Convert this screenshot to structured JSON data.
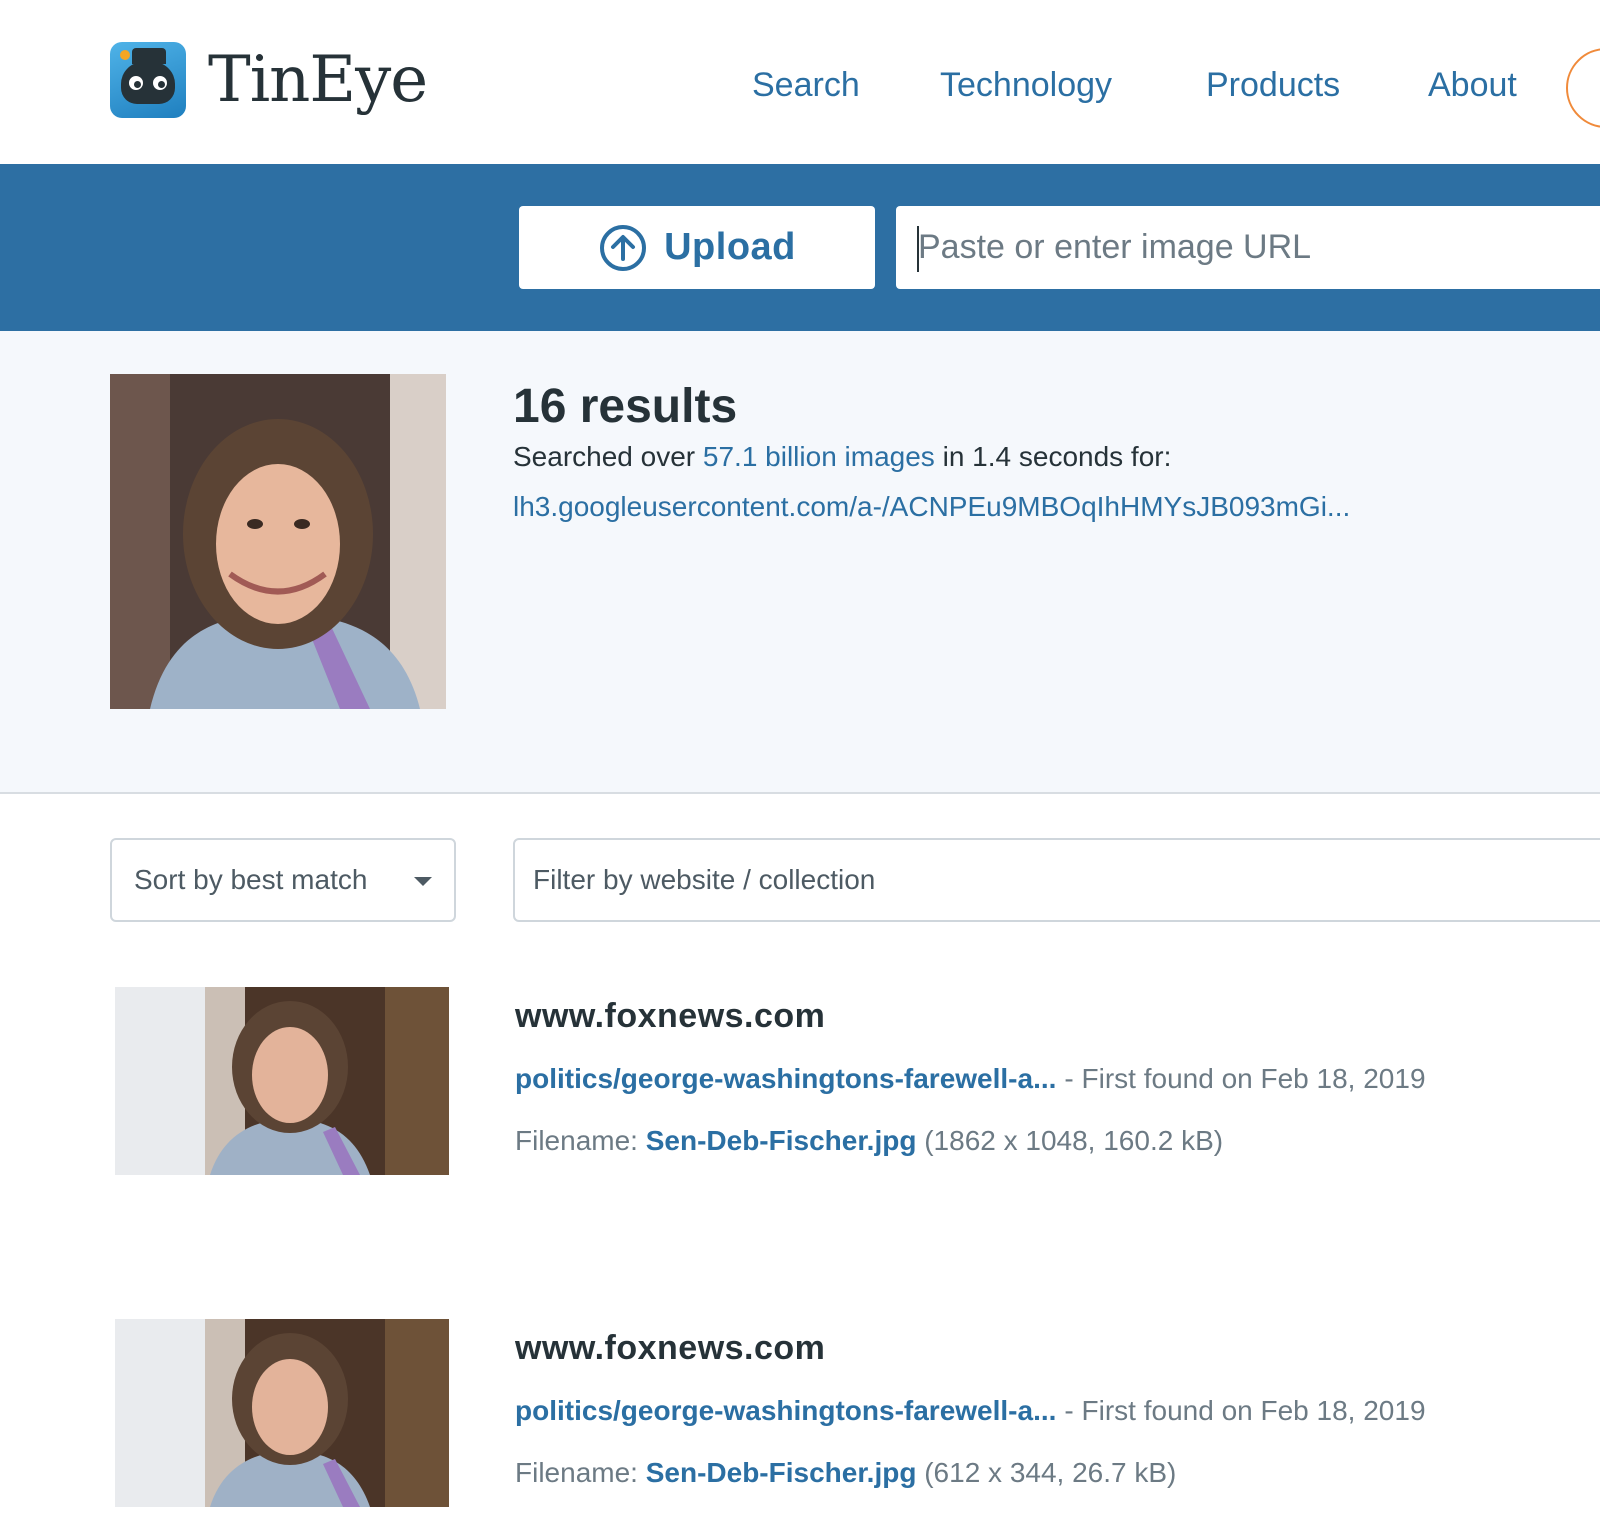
{
  "brand": {
    "name": "TinEye"
  },
  "nav": {
    "items": [
      {
        "label": "Search"
      },
      {
        "label": "Technology"
      },
      {
        "label": "Products"
      },
      {
        "label": "About"
      }
    ]
  },
  "search": {
    "upload_label": "Upload",
    "url_placeholder": "Paste or enter image URL",
    "url_value": ""
  },
  "summary": {
    "results_count": "16 results",
    "searched_prefix": "Searched over ",
    "searched_link": "57.1 billion images",
    "searched_suffix": " in 1.4 seconds for:",
    "query_url": "lh3.googleusercontent.com/a-/ACNPEu9MBOqIhHMYsJB093mGi..."
  },
  "controls": {
    "sort_value": "Sort by best match",
    "filter_placeholder": "Filter by website / collection"
  },
  "results": [
    {
      "domain": "www.foxnews.com",
      "page_link": "politics/george-washingtons-farewell-a...",
      "first_found": "- First found on Feb 18, 2019",
      "filename_label": "Filename:",
      "filename": "Sen-Deb-Fischer.jpg",
      "dims": "(1862 x 1048, 160.2 kB)"
    },
    {
      "domain": "www.foxnews.com",
      "page_link": "politics/george-washingtons-farewell-a...",
      "first_found": "- First found on Feb 18, 2019",
      "filename_label": "Filename:",
      "filename": "Sen-Deb-Fischer.jpg",
      "dims": "(612 x 344, 26.7 kB)"
    }
  ],
  "colors": {
    "accent": "#2b6fa3",
    "searchbar_bg": "#2d6fa3",
    "panel_bg": "#f5f8fc",
    "signin_border": "#f08a3a"
  }
}
